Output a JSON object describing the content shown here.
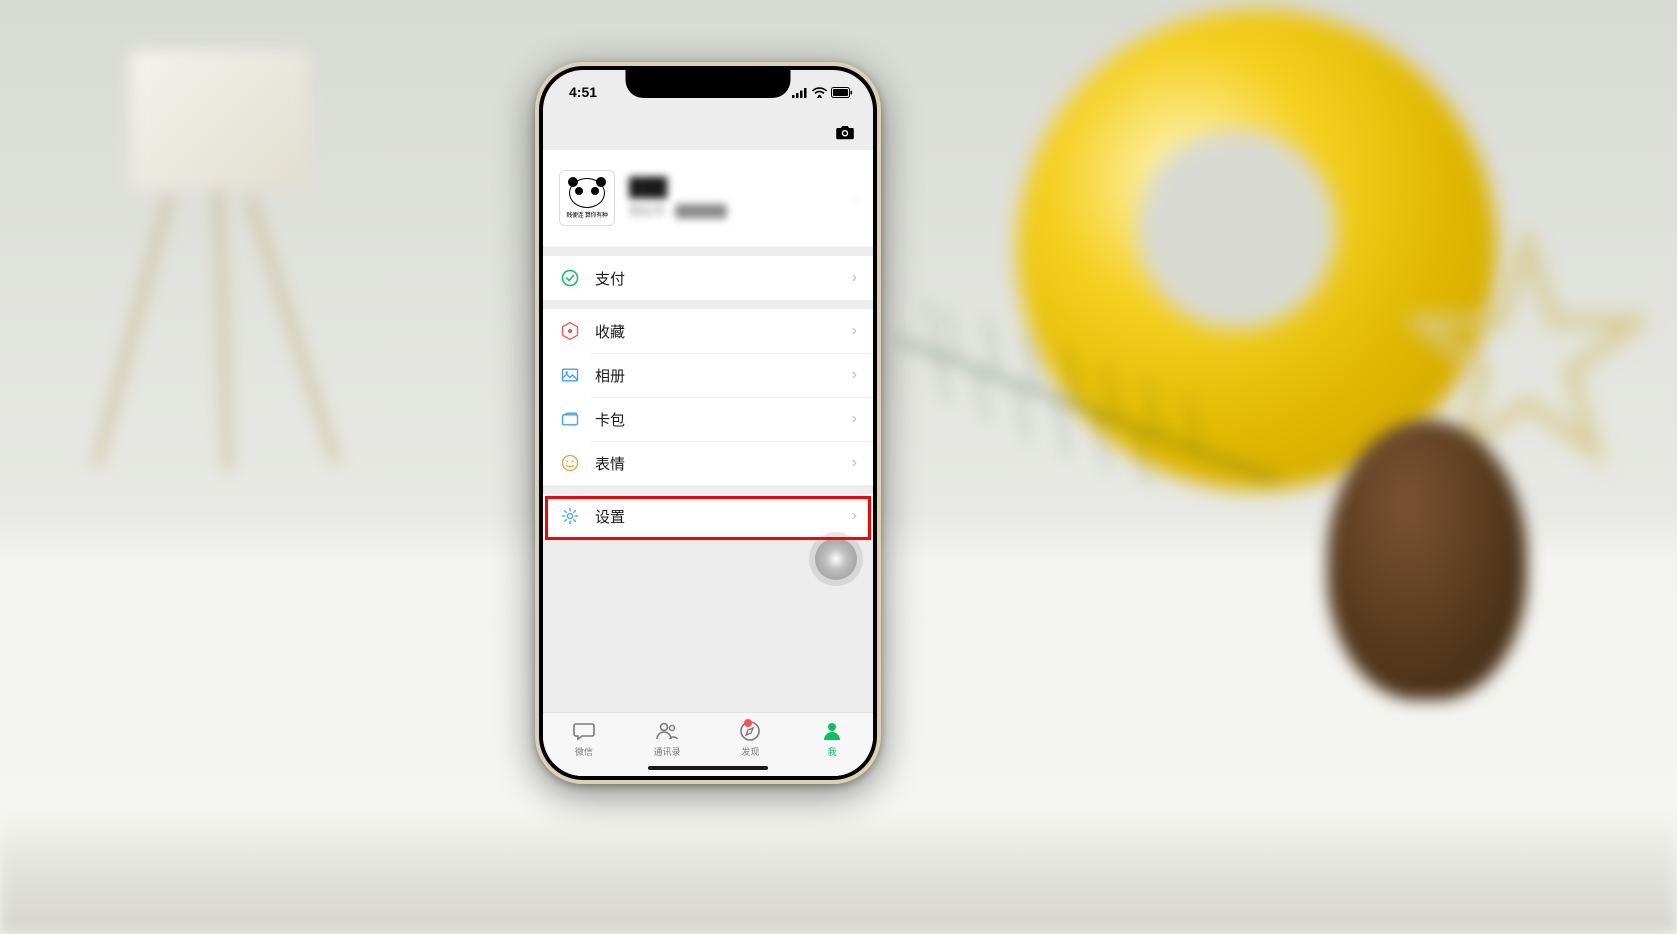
{
  "status_bar": {
    "time": "4:51"
  },
  "profile": {
    "name_blurred": "███",
    "sub_blurred": "微信号 · ██████",
    "avatar_caption": "贱便连 算你有种"
  },
  "menu_group_1": [
    {
      "icon": "pay",
      "label": "支付",
      "color": "#07c160"
    }
  ],
  "menu_group_2": [
    {
      "icon": "favorites",
      "label": "收藏",
      "color": "#f56c6c"
    },
    {
      "icon": "album",
      "label": "相册",
      "color": "#409eff"
    },
    {
      "icon": "cards",
      "label": "卡包",
      "color": "#409eff"
    },
    {
      "icon": "sticker",
      "label": "表情",
      "color": "#e6a23c"
    }
  ],
  "menu_group_3": [
    {
      "icon": "settings",
      "label": "设置",
      "color": "#409eff"
    }
  ],
  "tabs": [
    {
      "icon": "chat",
      "label": "微信",
      "active": false,
      "dot": false
    },
    {
      "icon": "contacts",
      "label": "通讯录",
      "active": false,
      "dot": false
    },
    {
      "icon": "discover",
      "label": "发现",
      "active": false,
      "dot": true
    },
    {
      "icon": "me",
      "label": "我",
      "active": true,
      "dot": false
    }
  ],
  "annotation": {
    "highlighted_item": "设置"
  }
}
